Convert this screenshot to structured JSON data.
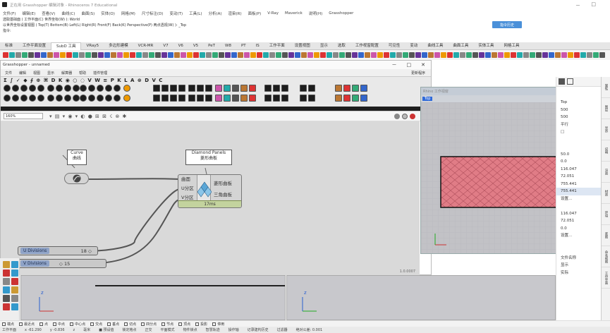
{
  "window": {
    "title": "正在用 Grasshopper 编辑对象 - Rhinoceros 7 Educational",
    "controls": [
      "－",
      "□"
    ]
  },
  "menu": [
    "文件(F)",
    "编辑(E)",
    "查看(V)",
    "曲线(C)",
    "曲面(S)",
    "实体(O)",
    "网格(M)",
    "尺寸标注(D)",
    "变动(T)",
    "工具(L)",
    "分析(A)",
    "渲染(R)",
    "面板(P)",
    "V-Ray",
    "Maverick",
    "说明(H)",
    "Grasshopper"
  ],
  "command": {
    "line1": "选取基础面 ( 工作平面(C) 世界坐标(W) ): World",
    "line2": "以世界坐标设置视图 ( Top(T) Bottom(B) Left(L) Right(R) Front(F) Back(K) Perspective(P) 两点透视(W) ): _Top",
    "prompt": "指令:",
    "button": "指令历史"
  },
  "toolbar_tabs": [
    "标准",
    "工作平面设置",
    "SubD 工具",
    "VRay5",
    "多边形建模",
    "VCR-MR",
    "V7",
    "V6",
    "V5",
    "PeT",
    "W8",
    "PT",
    "IS",
    "工作平面",
    "设置视图",
    "显示",
    "选取",
    "工作视窗配置",
    "可见性",
    "变动",
    "曲线工具",
    "曲面工具",
    "实体工具",
    "网格工具"
  ],
  "toolbar_active_tab": 2,
  "grasshopper": {
    "title": "Grasshopper - unnamed",
    "window_buttons": [
      "－",
      "□",
      "✕"
    ],
    "menu": [
      "文件",
      "编辑",
      "视图",
      "显示",
      "解算器",
      "帮助",
      "插件管理"
    ],
    "menu_right": "更新程序",
    "component_strip": "Σ ∫ ✓ ◆ ∮ ⊕ ⌘ D K ◉ ○ ◌ V W ≡ P K L A ⊛ D V C",
    "zoom": "160%",
    "toolbar_glyphs": "▾  ▤ ▾ ◉ ▾ ◐  ● ⊞ ⊠ ☇ ⊗ ✱",
    "version": "1.0.0007",
    "nodes": {
      "curve_label": [
        "Curve",
        "曲线"
      ],
      "diamond_label": [
        "Diamond Panels",
        "菱形曲板"
      ],
      "diamond_inputs": [
        "曲面",
        "U分区",
        "V分区"
      ],
      "diamond_outputs": [
        "菱形曲板",
        "三角曲板"
      ],
      "diamond_time": "17ms"
    },
    "sliders": [
      {
        "name": "U Divisions",
        "value": "18 ◇"
      },
      {
        "name": "V Divisions",
        "value": "◇ 15"
      }
    ]
  },
  "rhino_viewport": {
    "title": "Rhino 工作视窗",
    "view_name": "Top"
  },
  "properties": {
    "values": [
      "Top",
      "500",
      "500",
      "平行",
      "□",
      "",
      "",
      "50.0",
      "0.0",
      "116.047",
      "72.051",
      "755.441",
      "755.441",
      "设置...",
      "",
      "116.047",
      "72.051",
      "0.0",
      "设置...",
      "",
      "",
      "文件名称",
      "显示",
      "实际"
    ],
    "selected": 12
  },
  "right_tabs": [
    "属性",
    "图层",
    "显示",
    "说明",
    "渲染",
    "材质",
    "环境",
    "底图",
    "命名视图",
    "工作平面"
  ],
  "osnap": [
    "端点",
    "最近点",
    "点",
    "中点",
    "中心点",
    "交点",
    "垂点",
    "切点",
    "四分点",
    "节点",
    "顶点",
    "投影",
    "停用"
  ],
  "status_bar": [
    "工作平面",
    "x -61.290",
    "y -0.836",
    "z",
    "毫米",
    "■ 预设值",
    "锁定格点",
    "正交",
    "平面模式",
    "物件锁点",
    "智慧轨迹",
    "操作轴",
    "记录建构历史",
    "过滤器",
    "绝对公差: 0.001"
  ],
  "colors": {
    "surface_fill": "#e07c86",
    "rhino_accent": "#2f6ad9",
    "slider_name_bg": "#8fa3c7"
  }
}
